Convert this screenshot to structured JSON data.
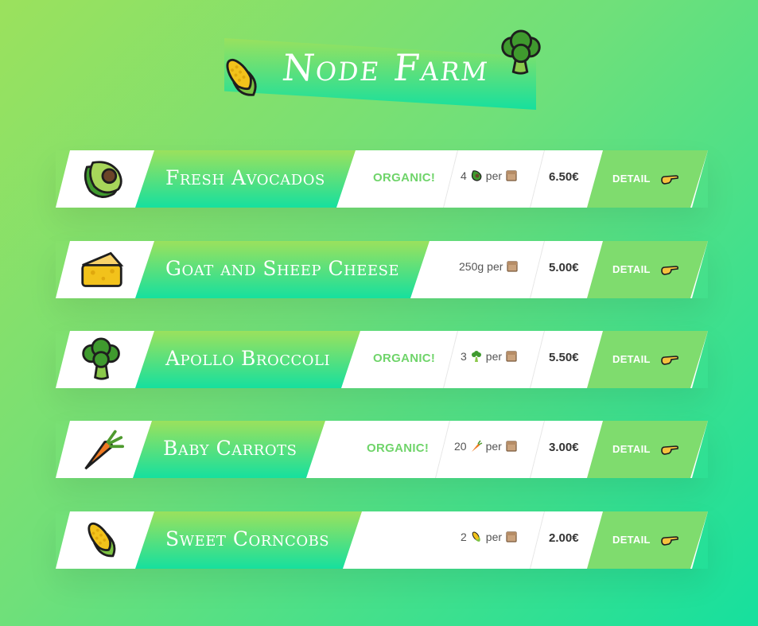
{
  "app": {
    "title": "Node Farm",
    "icons": {
      "left": "corn-icon",
      "right": "broccoli-icon"
    }
  },
  "products": [
    {
      "name": "Fresh Avocados",
      "organic": "ORGANIC!",
      "quantity": "4",
      "per": "per",
      "price": "6.50€",
      "detail": "DETAIL",
      "icon": "avocado-icon"
    },
    {
      "name": "Goat and Sheep Cheese",
      "organic": "",
      "quantity": "250g",
      "per": "per",
      "price": "5.00€",
      "detail": "DETAIL",
      "icon": "cheese-icon"
    },
    {
      "name": "Apollo Broccoli",
      "organic": "ORGANIC!",
      "quantity": "3",
      "per": "per",
      "price": "5.50€",
      "detail": "DETAIL",
      "icon": "broccoli-icon"
    },
    {
      "name": "Baby Carrots",
      "organic": "ORGANIC!",
      "quantity": "20",
      "per": "per",
      "price": "3.00€",
      "detail": "DETAIL",
      "icon": "carrot-icon"
    },
    {
      "name": "Sweet Corncobs",
      "organic": "",
      "quantity": "2",
      "per": "per",
      "price": "2.00€",
      "detail": "DETAIL",
      "icon": "corn-icon"
    }
  ]
}
